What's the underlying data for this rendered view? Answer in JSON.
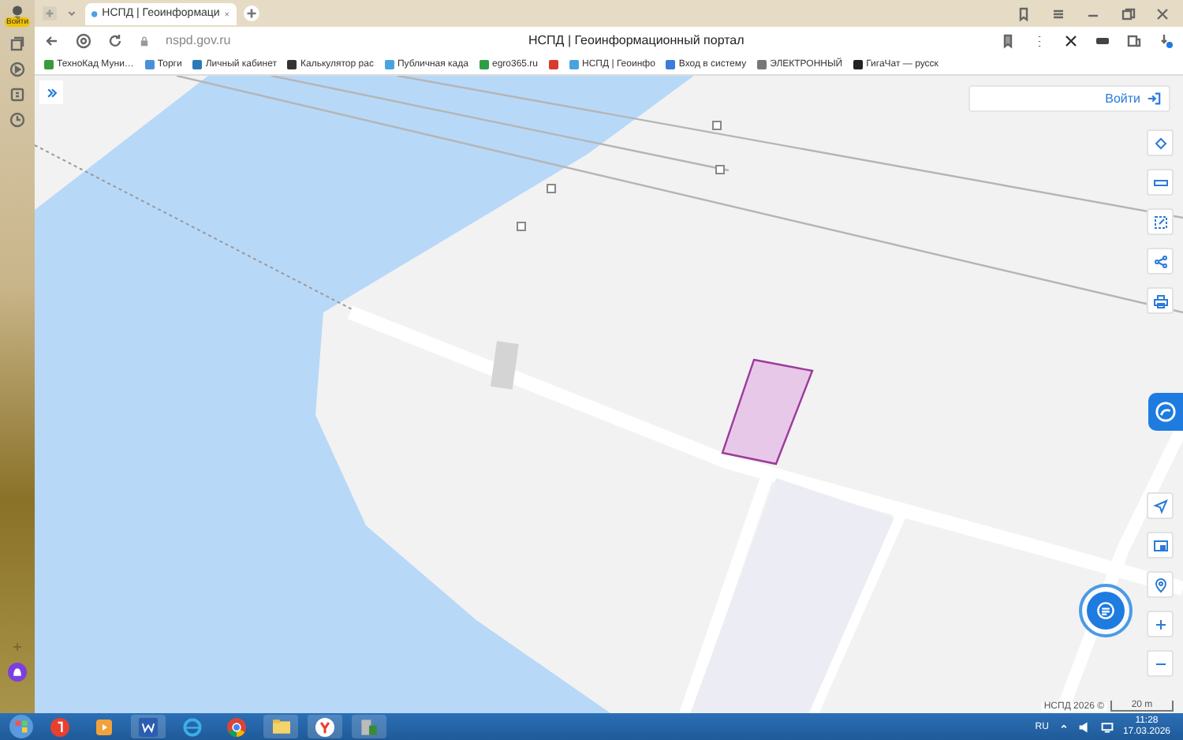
{
  "sidebar": {
    "profile_label": "Войти"
  },
  "tabs": [
    {
      "title": "НСПД | Геоинформаци",
      "selected": true
    }
  ],
  "address_bar": {
    "url": "nspd.gov.ru",
    "page_title": "НСПД | Геоинформационный портал"
  },
  "bookmarks": [
    {
      "label": "ТехноКад Муни…",
      "color": "#3a9a3a"
    },
    {
      "label": "Торги",
      "color": "#4a90d9"
    },
    {
      "label": "Личный кабинет",
      "color": "#2a7ab8"
    },
    {
      "label": "Калькулятор рас",
      "color": "#333333"
    },
    {
      "label": "Публичная када",
      "color": "#4aa3df"
    },
    {
      "label": "egro365.ru",
      "color": "#2e9e44"
    },
    {
      "color": "#d93a2b"
    },
    {
      "label": "НСПД | Геоинфо",
      "color": "#4aa3df"
    },
    {
      "label": "Вход в систему",
      "color": "#3b7dd8"
    },
    {
      "label": "ЭЛЕКТРОННЫЙ",
      "color": "#777777"
    },
    {
      "label": "ГигаЧат — русск",
      "color": "#222222"
    }
  ],
  "map": {
    "login": "Войти",
    "attribution": "НСПД 2026 ©",
    "scale": "20 m"
  },
  "taskbar": {
    "language": "RU",
    "time": "11:28",
    "date": "17.03.2026"
  }
}
